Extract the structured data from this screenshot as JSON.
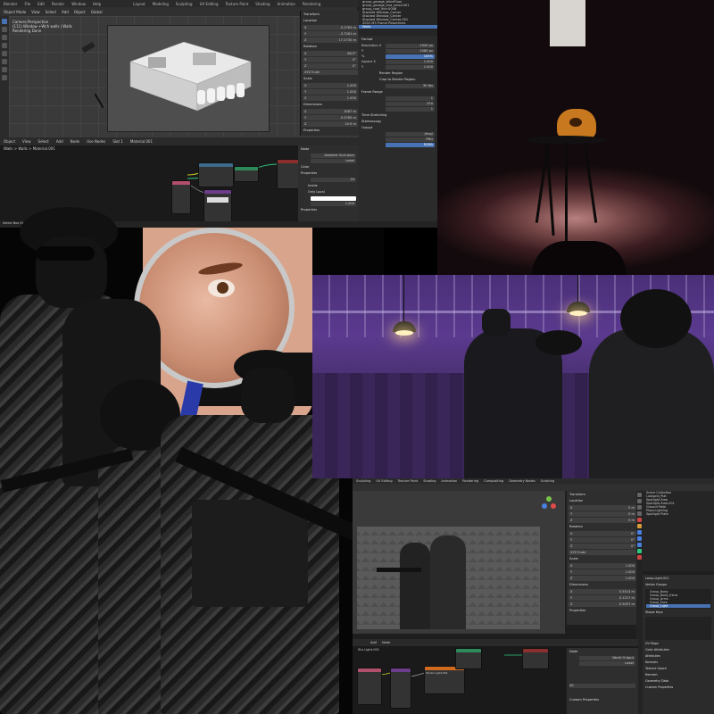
{
  "top_blender": {
    "menu": [
      "Blender",
      "File",
      "Edit",
      "Render",
      "Window",
      "Help"
    ],
    "tabs": [
      "Layout",
      "Modeling",
      "Sculpting",
      "UV Editing",
      "Texture Paint",
      "Shading",
      "Animation",
      "Rendering"
    ],
    "viewport_toolbar": [
      "Object Mode",
      "View",
      "Select",
      "Add",
      "Object",
      "Global"
    ],
    "camera_label_line1": "Camera Perspective",
    "camera_label_line2": "(111) Window +Wch walls | Walls",
    "camera_label_line3": "Rendering Done",
    "n_panel_title": "Transform",
    "n_panel_sections": [
      "Location",
      "Rotation",
      "Scale",
      "Dimensions"
    ],
    "n_panel_values": [
      "0.2783 m",
      "-3.7261 m",
      "17.2735 m",
      "88.9°",
      "0°",
      "0°",
      "1.000",
      "1.000",
      "1.000",
      "3087 m",
      "0.5765 m",
      "10.9 m"
    ],
    "n_panel_mode": "XYZ Euler",
    "n_panel_footer": "Properties",
    "outliner_rows": [
      "group_garage_blindFloor",
      "group_garage_eva_small.001",
      "group_roof_lfctr.0008",
      "Stacked Window_Comer",
      "Stacked Window_Center",
      "Stacked Window_Center.001",
      "2001 M3 Frame Powerlines",
      "Walls"
    ],
    "props_sections": [
      "Format",
      "Frame Range",
      "Time Stretching",
      "Stereoscopy",
      "Output"
    ],
    "props_fields": [
      "1920 px",
      "1080 px",
      "100%",
      "1.000",
      "1.000"
    ],
    "props_labels": [
      "Resolution X",
      "Y",
      "%",
      "Aspect X",
      "Y"
    ],
    "render_region": "Render Region",
    "crop": "Crop to Render Region",
    "frame_rate": "30 fps",
    "frame_start": "1",
    "frame_end": "250",
    "frame_step": "1",
    "output_path": "/tmp/",
    "file_format": "PNG",
    "color": "RGBA",
    "node_menu": [
      "Object",
      "View",
      "Select",
      "Add",
      "Node",
      "Use Nodes",
      "Slot 1",
      "Material.001"
    ],
    "node_breadcrumb": "Walls  >  Walls  >  Material.001",
    "node_panel_title": "Node",
    "node_panel_name": "Ambient Occlusion",
    "node_panel_label": "Label",
    "node_panel_sections": [
      "Color",
      "Properties",
      "Properties"
    ],
    "node_panel_fields": [
      "16",
      "1.000"
    ],
    "node_panel_checks": [
      "Inside",
      "Only Local"
    ],
    "status": "Select   Box Select   Pan View   Node Context Menu"
  },
  "bottom_blender": {
    "tabs": [
      "Sculpting",
      "UV Editing",
      "Texture Paint",
      "Shading",
      "Animation",
      "Rendering",
      "Compositing",
      "Geometry Nodes",
      "Scripting"
    ],
    "n_panel_title": "Transform",
    "n_panel_sections": [
      "Location",
      "Rotation",
      "Scale",
      "Dimensions"
    ],
    "n_panel_values": [
      "0 m",
      "0 m",
      "0 m",
      "0°",
      "0°",
      "0°",
      "1.000",
      "1.000",
      "1.000",
      "0.5514 m",
      "0.1217 m",
      "0.5057 m"
    ],
    "n_panel_mode": "XYZ Euler",
    "n_panel_footer": "Properties",
    "outliner_title": "Scene Collection",
    "outliner_rows": [
      "Lookgrid_Plat",
      "Spotlight Area",
      "Spotlight Area.001",
      "Ground Plate",
      "Plane.Lighting",
      "Spotlight Plate"
    ],
    "props_breadcrumb": "Lamp.Light.001",
    "props_sections": [
      "Vertex Groups",
      "Shape Keys",
      "UV Maps",
      "Color Attributes",
      "Attributes",
      "Normals",
      "Texture Space",
      "Remesh",
      "Geometry Data",
      "Custom Properties"
    ],
    "vertex_groups": [
      "Group_Body",
      "Group_Body_Extra",
      "Group_Arms",
      "Group_Face",
      "Group_Light"
    ],
    "node_menu": [
      "Add",
      "Node"
    ],
    "node_breadcrumb": "Stu Light.001",
    "node_panel_title": "Node",
    "node_panel_name": "World Output",
    "node_panel_label": "Label",
    "node_panel_field": "All",
    "node_panel_footer": "Custom Properties",
    "node_titles": [
      "Studio Light.001"
    ]
  },
  "colors": {
    "blender_bg": "#1e1e1e",
    "blender_accent": "#4772b3",
    "purple_scene": "#5b3a8f",
    "chair_floor": "#b88080"
  }
}
